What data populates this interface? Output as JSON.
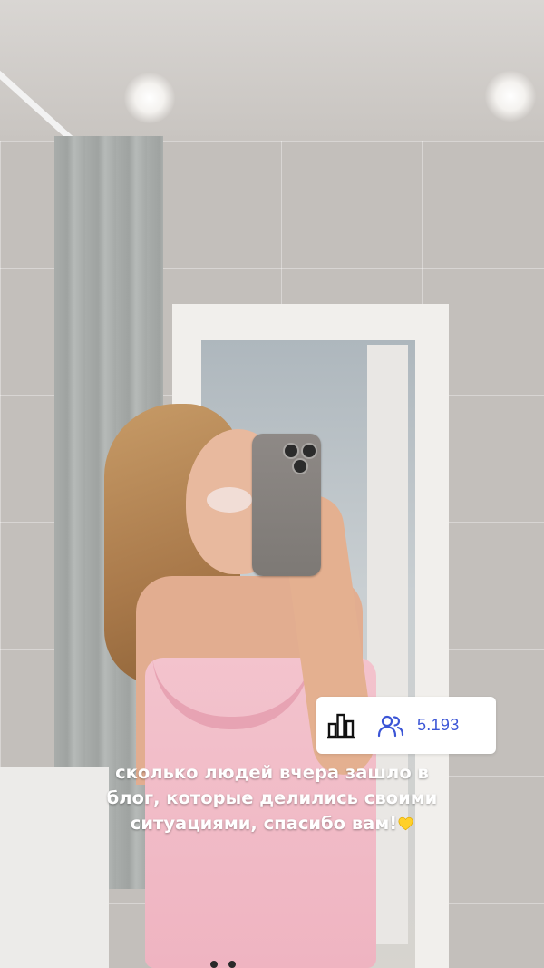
{
  "poll_sticker": {
    "viewer_count": "5.193",
    "accent_color": "#3b55d6",
    "icons": [
      "bar-chart-icon",
      "users-icon"
    ]
  },
  "caption": {
    "line1": "сколько людей вчера зашло в",
    "line2": "блог, которые делились своими",
    "line3": "ситуациями, спасибо вам!",
    "emoji": "yellow-heart-icon"
  }
}
